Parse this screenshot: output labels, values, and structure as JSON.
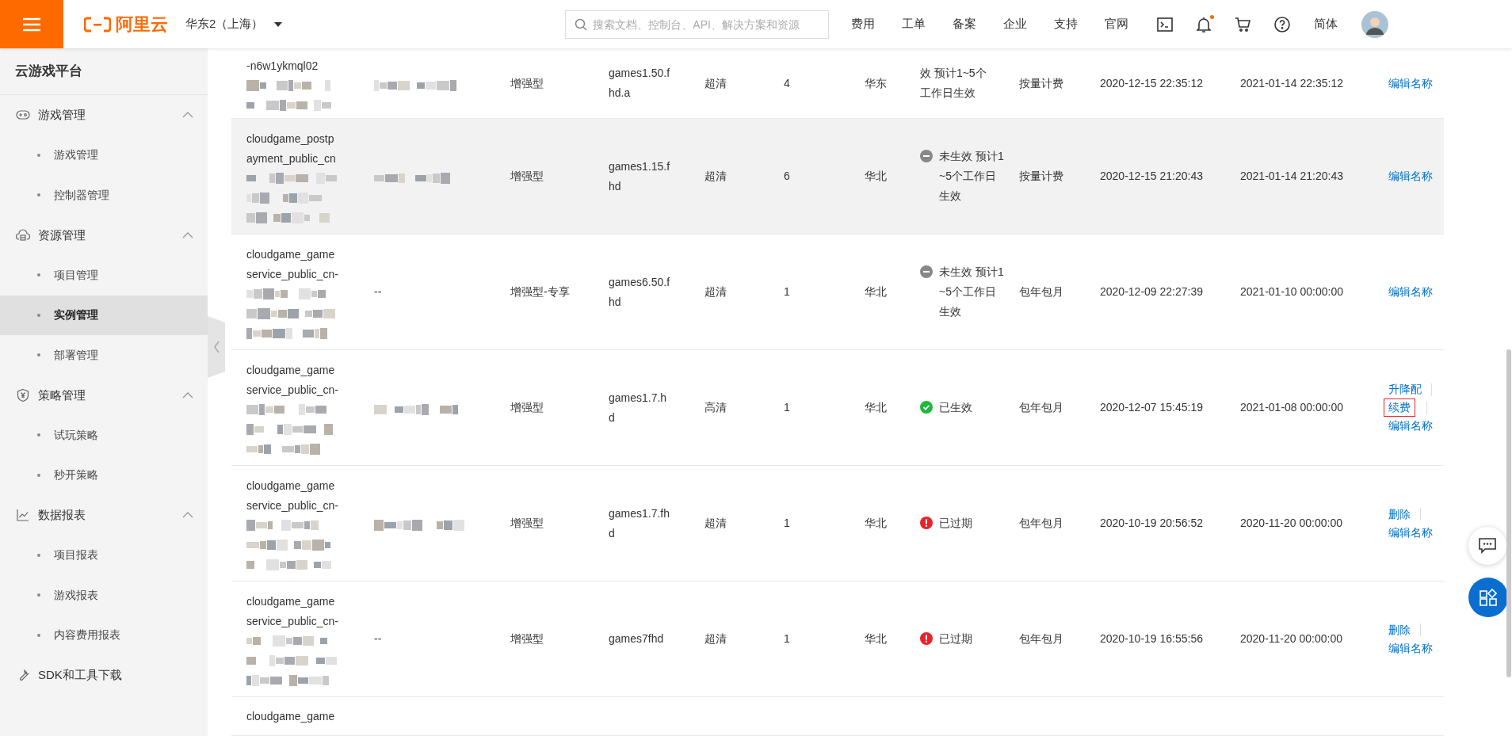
{
  "header": {
    "logo_text": "阿里云",
    "region": "华东2（上海）",
    "search": {
      "placeholder": "搜索文档、控制台、API、解决方案和资源"
    },
    "nav": [
      "费用",
      "工单",
      "备案",
      "企业",
      "支持",
      "官网"
    ],
    "notification_dot": true,
    "language": "简体"
  },
  "sidebar": {
    "title": "云游戏平台",
    "groups": [
      {
        "label": "游戏管理",
        "kind": "gamepad",
        "expanded": true,
        "children": [
          {
            "label": "游戏管理",
            "selected": false
          },
          {
            "label": "控制器管理",
            "selected": false
          }
        ]
      },
      {
        "label": "资源管理",
        "kind": "cloud",
        "expanded": true,
        "children": [
          {
            "label": "项目管理",
            "selected": false
          },
          {
            "label": "实例管理",
            "selected": true
          },
          {
            "label": "部署管理",
            "selected": false
          }
        ]
      },
      {
        "label": "策略管理",
        "kind": "shield",
        "expanded": true,
        "children": [
          {
            "label": "试玩策略",
            "selected": false
          },
          {
            "label": "秒开策略",
            "selected": false
          }
        ]
      },
      {
        "label": "数据报表",
        "kind": "chart",
        "expanded": true,
        "children": [
          {
            "label": "项目报表",
            "selected": false
          },
          {
            "label": "游戏报表",
            "selected": false
          },
          {
            "label": "内容费用报表",
            "selected": false
          }
        ]
      },
      {
        "label": "SDK和工具下载",
        "kind": "wrench"
      }
    ]
  },
  "table": {
    "rows": [
      {
        "name": "-n6w1ykmql02",
        "redacted": true,
        "column_2": {
          "kind": "picture"
        },
        "type": "增强型",
        "spec": "games1.50.f\nhd.a",
        "quality": "超清",
        "count": "4",
        "region": "华东",
        "status": {
          "text": "效 预计1~5个工作日生效"
        },
        "billing": "按量计费",
        "created": "2020-12-15 22:35:12",
        "expires": "2021-01-14 22:35:12",
        "actions": [
          {
            "label": "编辑名称",
            "highlighted": false
          }
        ],
        "hover": false
      },
      {
        "name": "cloudgame_postp\nayment_public_cn",
        "redacted": true,
        "column_2": {
          "kind": "picture"
        },
        "type": "增强型",
        "spec": "games1.15.f\nhd",
        "quality": "超清",
        "count": "6",
        "region": "华北",
        "status": {
          "kind": "pending",
          "text": "未生效 预计1~5个工作日生效"
        },
        "billing": "按量计费",
        "created": "2020-12-15 21:20:43",
        "expires": "2021-01-14 21:20:43",
        "actions": [
          {
            "label": "编辑名称",
            "highlighted": false
          }
        ],
        "hover": true
      },
      {
        "name": "cloudgame_game\nservice_public_cn-",
        "redacted": true,
        "column_2": {
          "kind": "text",
          "text": "--"
        },
        "type": "增强型-专享",
        "spec": "games6.50.f\nhd",
        "quality": "超清",
        "count": "1",
        "region": "华北",
        "status": {
          "kind": "pending",
          "text": "未生效 预计1~5个工作日生效"
        },
        "billing": "包年包月",
        "created": "2020-12-09 22:27:39",
        "expires": "2021-01-10 00:00:00",
        "actions": [
          {
            "label": "编辑名称",
            "highlighted": false
          }
        ],
        "hover": false
      },
      {
        "name": "cloudgame_game\nservice_public_cn-",
        "redacted": true,
        "column_2": {
          "kind": "picture"
        },
        "type": "增强型",
        "spec": "games1.7.h\nd",
        "quality": "高清",
        "count": "1",
        "region": "华北",
        "status": {
          "kind": "active",
          "text": "已生效"
        },
        "billing": "包年包月",
        "created": "2020-12-07 15:45:19",
        "expires": "2021-01-08 00:00:00",
        "actions": [
          {
            "label": "升降配",
            "highlighted": false
          },
          {
            "label": "续费",
            "highlighted": true
          },
          {
            "label": "编辑名称",
            "highlighted": false
          }
        ],
        "hover": false
      },
      {
        "name": "cloudgame_game\nservice_public_cn-",
        "redacted": true,
        "column_2": {
          "kind": "picture"
        },
        "type": "增强型",
        "spec": "games1.7.fh\nd",
        "quality": "超清",
        "count": "1",
        "region": "华北",
        "status": {
          "kind": "expired",
          "text": "已过期"
        },
        "billing": "包年包月",
        "created": "2020-10-19 20:56:52",
        "expires": "2020-11-20 00:00:00",
        "actions": [
          {
            "label": "删除",
            "highlighted": false
          },
          {
            "label": "编辑名称",
            "highlighted": false
          }
        ],
        "hover": false
      },
      {
        "name": "cloudgame_game\nservice_public_cn-",
        "redacted": true,
        "column_2": {
          "kind": "text",
          "text": "--"
        },
        "type": "增强型",
        "spec": "games7fhd",
        "quality": "超清",
        "count": "1",
        "region": "华北",
        "status": {
          "kind": "expired",
          "text": "已过期"
        },
        "billing": "包年包月",
        "created": "2020-10-19 16:55:56",
        "expires": "2020-11-20 00:00:00",
        "actions": [
          {
            "label": "删除",
            "highlighted": false
          },
          {
            "label": "编辑名称",
            "highlighted": false
          }
        ],
        "hover": false
      },
      {
        "name": "cloudgame_game",
        "redacted": false,
        "hover": false
      }
    ]
  }
}
